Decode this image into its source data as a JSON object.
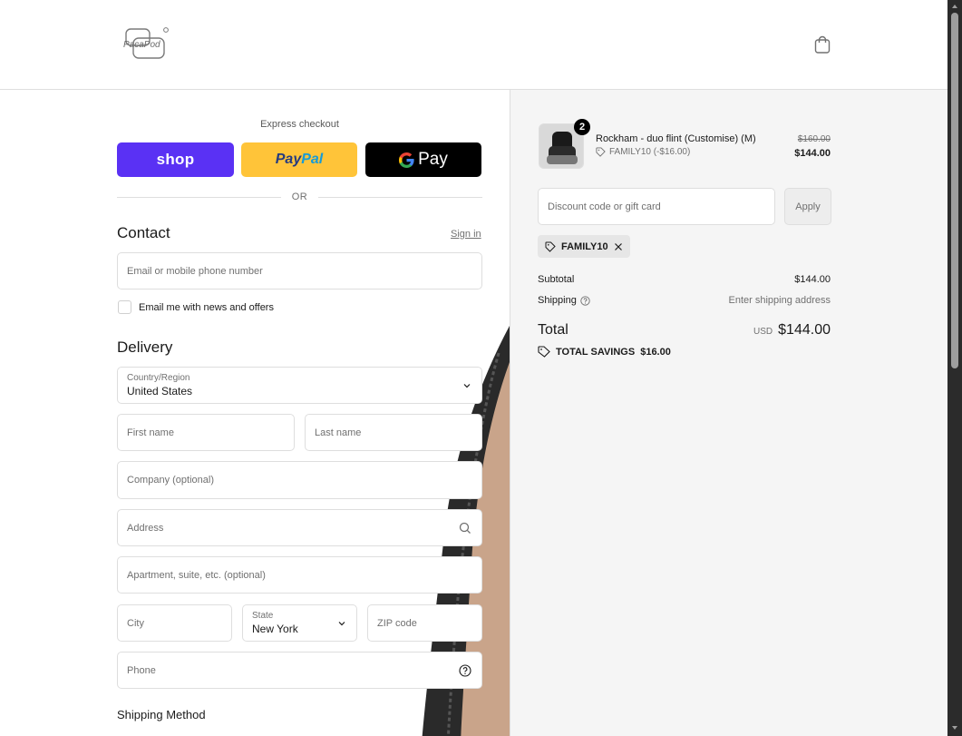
{
  "header": {
    "logo_text": "PacaPod",
    "bag_icon": "shopping-bag-icon"
  },
  "express": {
    "title": "Express checkout",
    "shop_label": "shop",
    "paypal_label_1": "Pay",
    "paypal_label_2": "Pal",
    "gpay_label": "Pay",
    "or_label": "OR"
  },
  "contact": {
    "title": "Contact",
    "sign_in": "Sign in",
    "email_placeholder": "Email or mobile phone number",
    "newsletter_label": "Email me with news and offers"
  },
  "delivery": {
    "title": "Delivery",
    "country_label": "Country/Region",
    "country_value": "United States",
    "first_name": "First name",
    "last_name": "Last name",
    "company": "Company (optional)",
    "address": "Address",
    "apartment": "Apartment, suite, etc. (optional)",
    "city": "City",
    "state_label": "State",
    "state_value": "New York",
    "zip": "ZIP code",
    "phone": "Phone"
  },
  "shipping_method": {
    "title": "Shipping Method"
  },
  "summary": {
    "product": {
      "quantity": "2",
      "title": "Rockham - duo flint (Customise) (M)",
      "discount": "FAMILY10 (-$16.00)",
      "price_old": "$160.00",
      "price_new": "$144.00"
    },
    "discount_placeholder": "Discount code or gift card",
    "apply_label": "Apply",
    "applied_code": "FAMILY10",
    "subtotal_label": "Subtotal",
    "subtotal_value": "$144.00",
    "shipping_label": "Shipping",
    "shipping_value": "Enter shipping address",
    "total_label": "Total",
    "total_currency": "USD",
    "total_value": "$144.00",
    "savings_label": "TOTAL SAVINGS",
    "savings_value": "$16.00"
  },
  "colors": {
    "shop_pay": "#5a31f4",
    "paypal": "#ffc439",
    "gpay": "#000000",
    "summary_bg": "#f5f5f5"
  }
}
